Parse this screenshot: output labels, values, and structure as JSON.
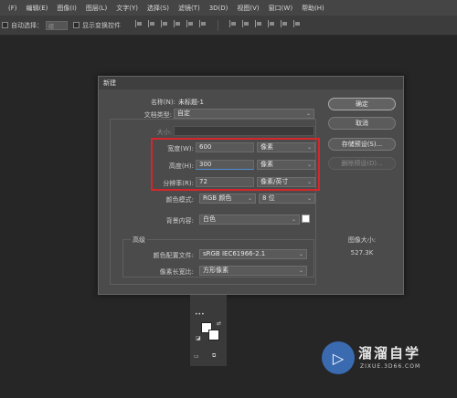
{
  "menu": [
    "(F)",
    "编辑(E)",
    "图像(I)",
    "图层(L)",
    "文字(Y)",
    "选择(S)",
    "滤镜(T)",
    "3D(D)",
    "视图(V)",
    "窗口(W)",
    "帮助(H)"
  ],
  "options": {
    "auto_select": "自动选择：",
    "auto_select_value": "组",
    "show_transform": "显示变换控件"
  },
  "dialog": {
    "title": "新建",
    "name_label": "名称(N):",
    "name_value": "未标题-1",
    "preset_label": "文档类型:",
    "preset_value": "自定",
    "size_label": "大小:",
    "width_label": "宽度(W):",
    "width_value": "600",
    "width_unit": "像素",
    "height_label": "高度(H):",
    "height_value": "300",
    "height_unit": "像素",
    "resolution_label": "分辨率(R):",
    "resolution_value": "72",
    "resolution_unit": "像素/英寸",
    "color_mode_label": "颜色模式:",
    "color_mode_value": "RGB 颜色",
    "bit_depth_value": "8 位",
    "background_label": "背景内容:",
    "background_value": "白色",
    "advanced_label": "高级",
    "profile_label": "颜色配置文件:",
    "profile_value": "sRGB IEC61966-2.1",
    "pixel_aspect_label": "像素长宽比:",
    "pixel_aspect_value": "方形像素",
    "ok_button": "确定",
    "cancel_button": "取消",
    "save_preset_button": "存储预设(S)...",
    "delete_preset_button": "删除预设(D)...",
    "image_size_label": "图像大小:",
    "image_size_value": "527.3K"
  },
  "watermark": {
    "name": "溜溜自学",
    "url": "ZIXUE.3D66.COM"
  }
}
